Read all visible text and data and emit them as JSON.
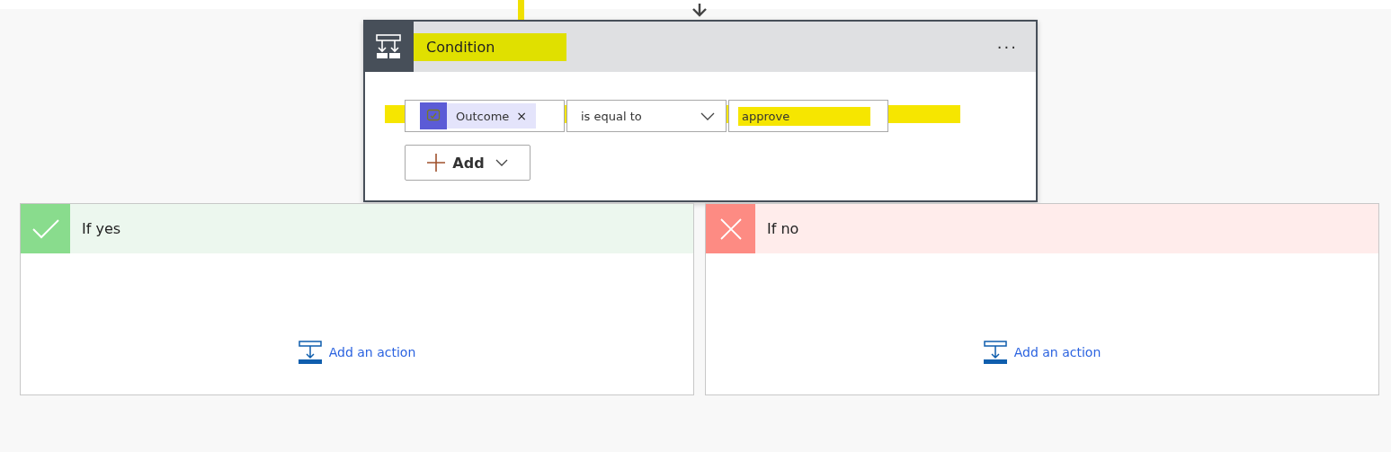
{
  "condition": {
    "title": "Condition",
    "title_highlighted": true,
    "menu": "···",
    "rule": {
      "token": {
        "label": "Outcome",
        "remove": "×",
        "highlighted": true
      },
      "operator": "is equal to",
      "value": "approve",
      "value_highlighted": true
    },
    "add_button": "Add"
  },
  "branches": [
    {
      "kind": "yes",
      "title": "If yes",
      "action": "Add an action"
    },
    {
      "kind": "no",
      "title": "If no",
      "action": "Add an action"
    }
  ]
}
